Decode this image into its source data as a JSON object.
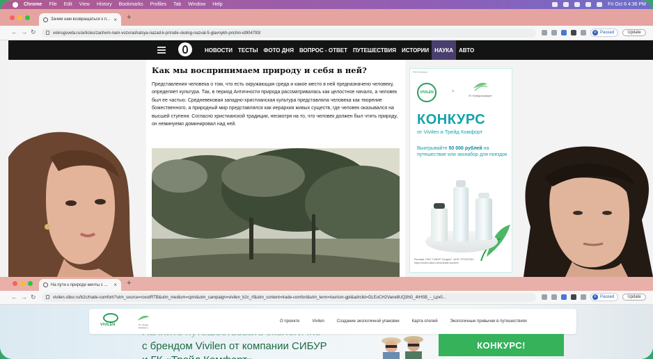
{
  "menubar": {
    "app": "Chrome",
    "items": [
      "File",
      "Edit",
      "View",
      "History",
      "Bookmarks",
      "Profiles",
      "Tab",
      "Window",
      "Help"
    ],
    "clock": "Fri Oct 6  4:36 PM"
  },
  "browser1": {
    "tab_title": "Зачем нам возвращаться к п...",
    "url": "vokrugsveta.ru/articles/zachem-nam-vozvrashatsya-nazad-k-prirode-skolog-nazval-5-glavnykh-prichin-id904793/",
    "paused": "Paused",
    "profile_initial": "R",
    "update": "Update"
  },
  "site_nav": {
    "items": [
      "НОВОСТИ",
      "ТЕСТЫ",
      "ФОТО ДНЯ",
      "ВОПРОС - ОТВЕТ",
      "ПУТЕШЕСТВИЯ",
      "ИСТОРИИ",
      "НАУКА",
      "АВТО"
    ],
    "active": "НАУКА"
  },
  "article": {
    "title": "Как мы воспринимаем природу и себя в ней?",
    "paragraph": "Представления человека о том, что есть окружающая среда и какое место в ней предназначено человеку, определяет культура. Так, в период Античности природа рассматривалась как целостное начало, а человек был ее частью. Средневековая западно-христианская культура представляла человека как творение божественного, а природный мир представлялся как иерархия живых существ, где человек оказывался на высшей ступени. Согласно христианской традиции, несмотря на то, что человек должен был чтить природу, он неминуемо доминировал над ней."
  },
  "ad": {
    "label": "РЕКЛАМА",
    "brand1": "VIVILEN",
    "x": "×",
    "brand2": "ГК «Трейд Комфорт»",
    "headline": "КОНКУРС",
    "subhead": "от Vivilen и Трейд Комфорт",
    "win_prefix": "Выигрывайте ",
    "win_amount": "50 000 рублей",
    "win_suffix": " на путешествие или эконабор для поездок",
    "footer": "Реклама. ПАО \"СИБУР Холдинг\", ИНН 7727547261, https://vivilen.sibur.ru/b2c/trade-comfort/"
  },
  "browser2": {
    "tab_title": "На пути к природе мечты с ...",
    "url": "vivilen.sibur.ru/b2c/trade-comfort/?utm_source=roxotRTB&utm_medium=cpm&utm_campaign=vivilen_b2c_rf&utm_content=trade-comfort&utm_term=tourism-gpt&adrclid=DLEoCH2Vane8UQ3hG_4IHSB_-_Lpx0...",
    "paused": "Paused",
    "profile_initial": "R",
    "update": "Update"
  },
  "page2": {
    "logo1": "VIVILEN",
    "logo2": "ГК «Трейд Комфорт»",
    "nav": [
      "О проекте",
      "Vivilen",
      "Создание экологичной упаковки",
      "Карта отелей",
      "Экологичные привычки в путешествиях"
    ],
    "hero_line1": "Начните путешествовать экологично",
    "hero_line2": "с брендом Vivilen от компании СИБУР",
    "hero_line3": "и ГК «Трейд Комфорт»",
    "konkurs_button": "КОНКУРС!"
  },
  "colors": {
    "accent_teal": "#12a3ad",
    "vivilen_green": "#26a05b",
    "nav_active": "#4a3e6e",
    "konkurs_green": "#35b25a"
  }
}
